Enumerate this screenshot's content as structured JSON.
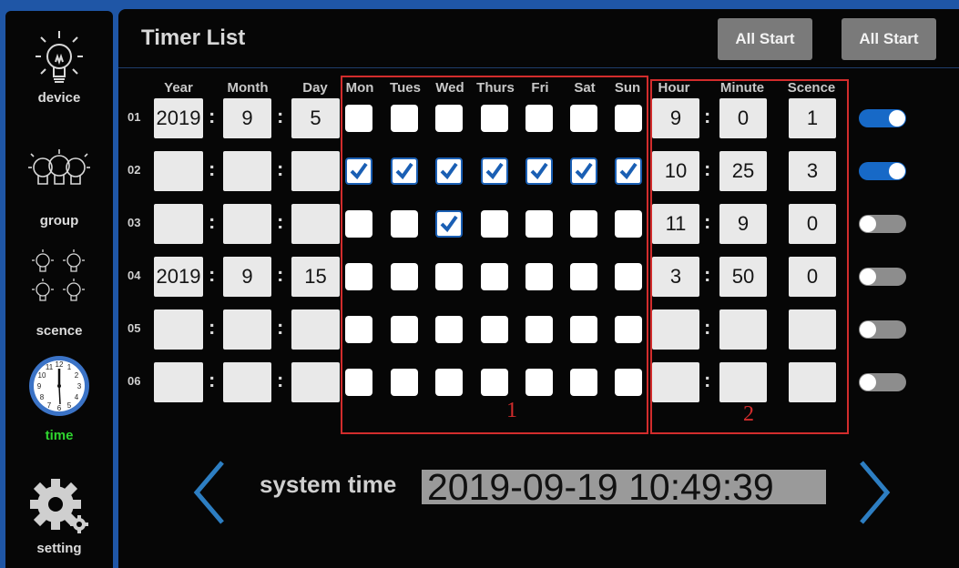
{
  "sidebar": {
    "items": [
      {
        "label": "device",
        "icon": "bulb-icon"
      },
      {
        "label": "group",
        "icon": "bulb-group-icon"
      },
      {
        "label": "scence",
        "icon": "bulbs-grid-icon"
      },
      {
        "label": "time",
        "icon": "clock-icon",
        "active": true
      },
      {
        "label": "setting",
        "icon": "gear-icon"
      }
    ]
  },
  "header": {
    "title": "Timer List",
    "button_1": "All Start",
    "button_2": "All Start"
  },
  "columns": {
    "year": "Year",
    "month": "Month",
    "day": "Day",
    "days": [
      "Mon",
      "Tues",
      "Wed",
      "Thurs",
      "Fri",
      "Sat",
      "Sun"
    ],
    "hour": "Hour",
    "minute": "Minute",
    "scene": "Scence"
  },
  "timers": [
    {
      "num": "01",
      "year": "2019",
      "month": "9",
      "day": "5",
      "days": [
        false,
        false,
        false,
        false,
        false,
        false,
        false
      ],
      "hour": "9",
      "minute": "0",
      "scene": "1",
      "enabled": true
    },
    {
      "num": "02",
      "year": "",
      "month": "",
      "day": "",
      "days": [
        true,
        true,
        true,
        true,
        true,
        true,
        true
      ],
      "hour": "10",
      "minute": "25",
      "scene": "3",
      "enabled": true
    },
    {
      "num": "03",
      "year": "",
      "month": "",
      "day": "",
      "days": [
        false,
        false,
        true,
        false,
        false,
        false,
        false
      ],
      "hour": "11",
      "minute": "9",
      "scene": "0",
      "enabled": false
    },
    {
      "num": "04",
      "year": "2019",
      "month": "9",
      "day": "15",
      "days": [
        false,
        false,
        false,
        false,
        false,
        false,
        false
      ],
      "hour": "3",
      "minute": "50",
      "scene": "0",
      "enabled": false
    },
    {
      "num": "05",
      "year": "",
      "month": "",
      "day": "",
      "days": [
        false,
        false,
        false,
        false,
        false,
        false,
        false
      ],
      "hour": "",
      "minute": "",
      "scene": "",
      "enabled": false
    },
    {
      "num": "06",
      "year": "",
      "month": "",
      "day": "",
      "days": [
        false,
        false,
        false,
        false,
        false,
        false,
        false
      ],
      "hour": "",
      "minute": "",
      "scene": "",
      "enabled": false
    }
  ],
  "annotations": {
    "box_1": "1",
    "box_2": "2"
  },
  "system_time": {
    "label": "system time",
    "value": "2019-09-19 10:49:39"
  },
  "colors": {
    "accent": "#1769c7",
    "active_label": "#2fd42f",
    "annotation": "#d22c2c",
    "frame": "#1f56a6"
  }
}
